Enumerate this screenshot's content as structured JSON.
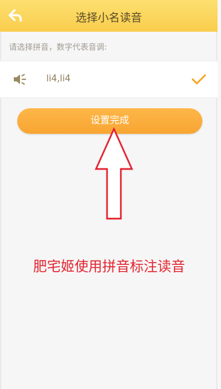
{
  "header": {
    "title": "选择小名读音"
  },
  "hint": "请选择拼音，数字代表音调:",
  "option": {
    "pinyin": "li4,li4",
    "selected": true
  },
  "action": {
    "label": "设置完成"
  },
  "annotation": {
    "text": "肥宅姬使用拼音标注读音",
    "color": "#e3232f"
  },
  "colors": {
    "header": "#fbd65a",
    "accent": "#f8a532",
    "check": "#f5a623"
  },
  "icons": [
    "back-arrow-icon",
    "speaker-icon",
    "checkmark-icon",
    "red-arrow-annotation"
  ]
}
